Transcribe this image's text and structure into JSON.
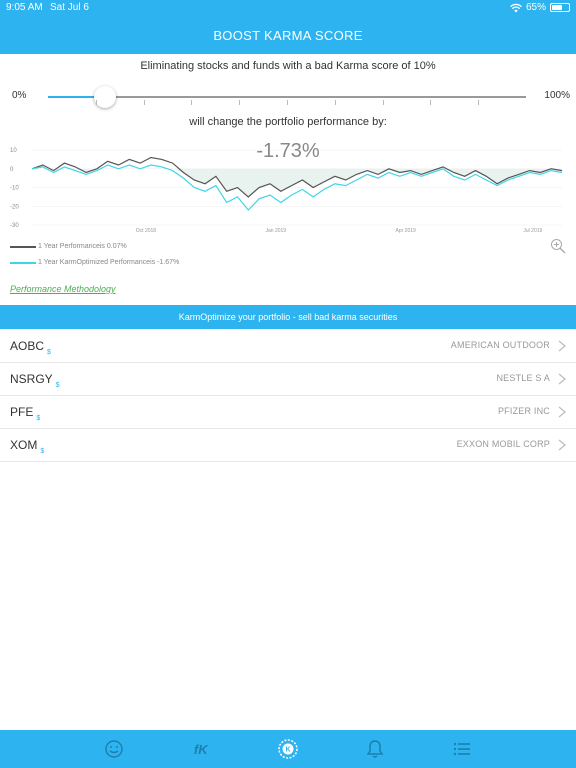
{
  "status_bar": {
    "time": "9:05 AM",
    "date": "Sat Jul 6",
    "battery": "65%",
    "battery_level": 0.65
  },
  "nav": {
    "title": "BOOST KARMA SCORE"
  },
  "subtitle": "Eliminating stocks and funds with a bad Karma score of 10%",
  "slider": {
    "min_label": "0%",
    "max_label": "100%",
    "value": 0.12
  },
  "change_text": "will change the portfolio performance by:",
  "change_value": "-1.73%",
  "chart_data": {
    "type": "line",
    "x_tick_labels": [
      "Oct 2018",
      "Jan 2019",
      "Apr 2019",
      "Jul 2019"
    ],
    "y_tick_labels": [
      "10",
      "0",
      "-10",
      "-20",
      "-30"
    ],
    "ylim": [
      -30,
      10
    ],
    "series": [
      {
        "color": "#555555",
        "values": [
          0,
          2,
          -1,
          3,
          1,
          -2,
          0,
          4,
          2,
          5,
          3,
          6,
          5,
          3,
          -2,
          -6,
          -8,
          -4,
          -12,
          -10,
          -15,
          -10,
          -8,
          -12,
          -9,
          -6,
          -10,
          -7,
          -4,
          -6,
          -3,
          -1,
          -3,
          0,
          -2,
          -1,
          -3,
          -1,
          1,
          -2,
          -4,
          -1,
          -4,
          -8,
          -5,
          -3,
          -1,
          -2,
          0,
          -1
        ]
      },
      {
        "color": "#3dd6e6",
        "values": [
          0,
          1,
          -2,
          1,
          -1,
          -3,
          -1,
          2,
          0,
          2,
          0,
          2,
          1,
          -1,
          -5,
          -10,
          -12,
          -9,
          -18,
          -15,
          -22,
          -16,
          -14,
          -18,
          -14,
          -11,
          -15,
          -11,
          -8,
          -9,
          -6,
          -3,
          -5,
          -2,
          -4,
          -2,
          -4,
          -2,
          0,
          -4,
          -6,
          -3,
          -6,
          -9,
          -6,
          -4,
          -2,
          -3,
          -1,
          -2
        ]
      }
    ]
  },
  "legend": [
    {
      "prefix": "1 Year Performance ",
      "is_word": "is",
      "value": "0.07%",
      "color": "#555555"
    },
    {
      "prefix": "1 Year KarmOptimized Performance ",
      "is_word": "is",
      "value": "-1.67%",
      "color": "#3dd6e6"
    }
  ],
  "methodology_link": "Performance Methodology",
  "action_banner": "KarmOptimize your portfolio - sell bad karma securities",
  "securities": [
    {
      "ticker": "AOBC",
      "badge": "$",
      "company": "AMERICAN OUTDOOR"
    },
    {
      "ticker": "NSRGY",
      "badge": "$",
      "company": "NESTLE S A"
    },
    {
      "ticker": "PFE",
      "badge": "$",
      "company": "PFIZER INC"
    },
    {
      "ticker": "XOM",
      "badge": "$",
      "company": "EXXON MOBIL CORP"
    }
  ],
  "tabs": [
    {
      "icon": "smiley-face-icon"
    },
    {
      "icon": "fk-logo-icon",
      "label": "fK"
    },
    {
      "icon": "karma-k-icon"
    },
    {
      "icon": "bell-icon"
    },
    {
      "icon": "list-icon"
    }
  ],
  "colors": {
    "accent": "#2db4f0",
    "link": "#4caf50"
  }
}
